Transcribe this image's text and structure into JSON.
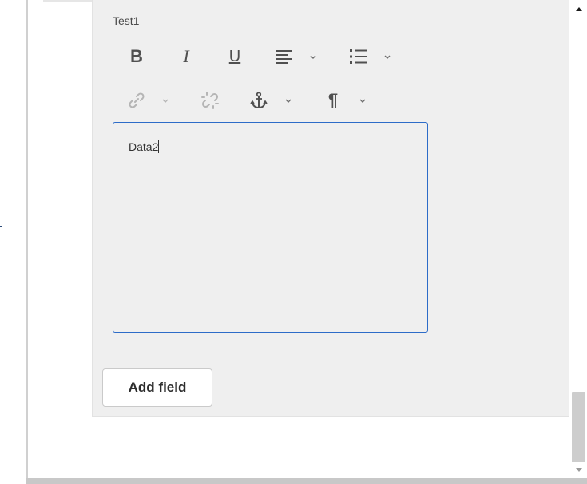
{
  "field": {
    "label": "Test1"
  },
  "toolbar": {
    "row1": [
      "bold",
      "italic",
      "underline",
      "align",
      "list"
    ],
    "row2": [
      "link",
      "unlink",
      "anchor",
      "paragraph"
    ],
    "bold_glyph": "B",
    "italic_glyph": "I",
    "underline_glyph": "U",
    "paragraph_glyph": "¶"
  },
  "editor": {
    "value": "Data2"
  },
  "actions": {
    "add_field_label": "Add field"
  },
  "colors": {
    "accent": "#2d6cc8",
    "panel_bg": "#efefef",
    "icon": "#505050"
  }
}
